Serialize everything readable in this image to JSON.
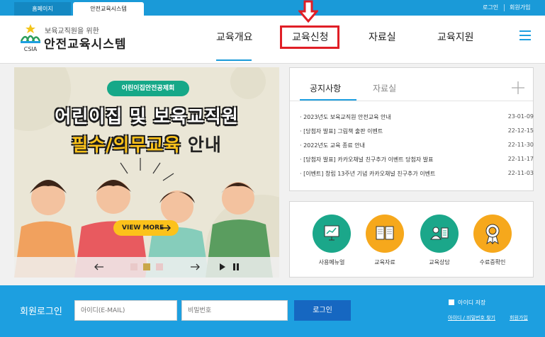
{
  "topbar": {
    "tabs": [
      "홈페이지",
      "안전교육시스템"
    ],
    "login_link": "로그인",
    "signup_link": "회원가입"
  },
  "header": {
    "logo_text": "CSIA",
    "logo_subtitle": "보육교직원을 위한",
    "logo_title": "안전교육시스템",
    "nav": [
      "교육개요",
      "교육신청",
      "자료실",
      "교육지원"
    ],
    "active_nav": "교육개요",
    "highlighted_nav": "교육신청"
  },
  "banner": {
    "chip": "어린이집안전공제회",
    "headline1": "어린이집 및 보육교직원",
    "headline2_highlight": "필수/의무교육",
    "headline2_rest": " 안내",
    "button": "VIEW MORE",
    "progress_dots": 3,
    "active_dot": 2
  },
  "notice": {
    "tabs": [
      "공지사항",
      "자료실"
    ],
    "rows": [
      {
        "title": "2023년도 보육교직원 안전교육 안내",
        "date": "23-01-09"
      },
      {
        "title": "[당첨자 발표] 그림책 출판 이벤트",
        "date": "22-12-15"
      },
      {
        "title": "2022년도 교육 종료 안내",
        "date": "22-11-30"
      },
      {
        "title": "[당첨자 발표] 카카오채널 친구추가 이벤트 당첨자 발표",
        "date": "22-11-17"
      },
      {
        "title": "[이벤트] 창립 13주년 기념 카카오채널 친구추가 이벤트",
        "date": "22-11-03"
      }
    ]
  },
  "quick": {
    "items": [
      {
        "label": "사용메뉴얼",
        "icon": "presentation-board-icon",
        "color": "#1ba78a"
      },
      {
        "label": "교육자료",
        "icon": "book-icon",
        "color": "#f6a81c"
      },
      {
        "label": "교육상담",
        "icon": "counseling-icon",
        "color": "#1ba78a"
      },
      {
        "label": "수료증확인",
        "icon": "award-medal-icon",
        "color": "#f6a81c"
      }
    ]
  },
  "login": {
    "title": "회원로그인",
    "id_placeholder": "아이디(E-MAIL)",
    "pw_placeholder": "비밀번호",
    "button": "로그인",
    "save_id": "아이디 저장",
    "find_link": "아이디 / 비밀번호 찾기",
    "signup_link": "회원가입"
  },
  "colors": {
    "primary": "#1d9fe0",
    "login_button": "#1667c1",
    "highlight": "#e01e26",
    "green": "#1ba78a",
    "yellow": "#f6a81c"
  }
}
